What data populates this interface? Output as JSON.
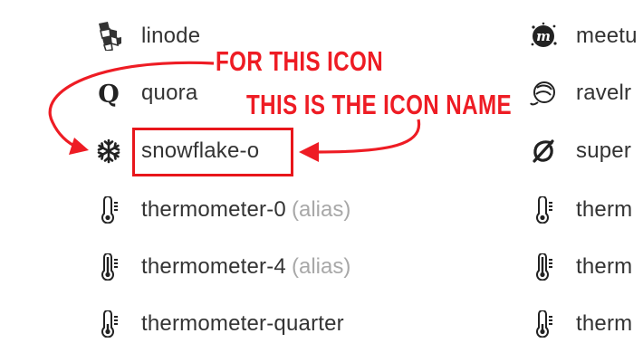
{
  "icons_left": [
    {
      "name": "linode",
      "alias": "",
      "icon": "linode-icon"
    },
    {
      "name": "quora",
      "alias": "",
      "icon": "quora-icon"
    },
    {
      "name": "snowflake-o",
      "alias": "",
      "icon": "snowflake-icon"
    },
    {
      "name": "thermometer-0",
      "alias": "(alias)",
      "icon": "thermometer-empty-icon"
    },
    {
      "name": "thermometer-4",
      "alias": "(alias)",
      "icon": "thermometer-full-icon"
    },
    {
      "name": "thermometer-quarter",
      "alias": "",
      "icon": "thermometer-quarter-icon"
    }
  ],
  "icons_right": [
    {
      "name": "meetu",
      "icon": "meetup-icon"
    },
    {
      "name": "ravelr",
      "icon": "ravelry-icon"
    },
    {
      "name": "super",
      "icon": "superpowers-icon"
    },
    {
      "name": "therm",
      "icon": "thermometer-icon"
    },
    {
      "name": "therm",
      "icon": "thermometer-icon"
    },
    {
      "name": "therm",
      "icon": "thermometer-icon"
    }
  ],
  "annotations": {
    "for_this_icon": "FOR THIS ICON",
    "icon_name": "THIS IS THE ICON NAME",
    "color": "#ee1c24"
  }
}
